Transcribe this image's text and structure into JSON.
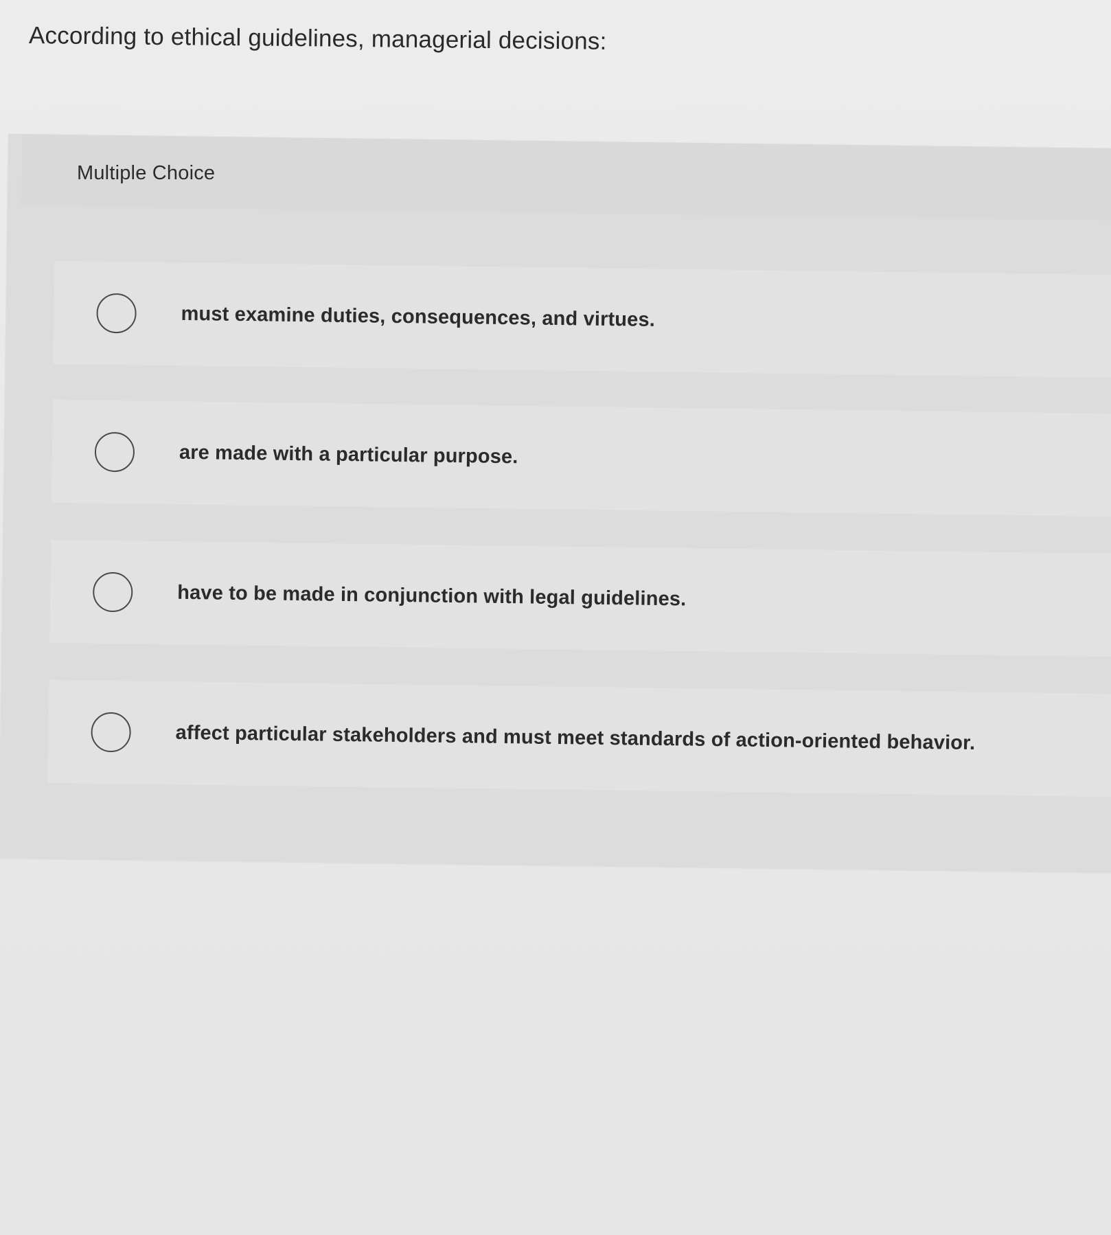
{
  "question": {
    "text": "According to ethical guidelines, managerial decisions:"
  },
  "multiple_choice": {
    "type_label": "Multiple Choice",
    "options": [
      {
        "label": "must examine duties, consequences, and virtues.",
        "selected": false
      },
      {
        "label": "are made with a particular purpose.",
        "selected": false
      },
      {
        "label": "have to be made in conjunction with legal guidelines.",
        "selected": false
      },
      {
        "label": "affect particular stakeholders and must meet standards of action-oriented behavior.",
        "selected": false
      }
    ]
  },
  "icons": {
    "radio": "radio-button-unselected-icon"
  },
  "colors": {
    "page_background": "#e8e8e8",
    "panel_background": "#dcdcdc",
    "option_background": "#e2e2e2",
    "text": "#2b2b2b"
  }
}
